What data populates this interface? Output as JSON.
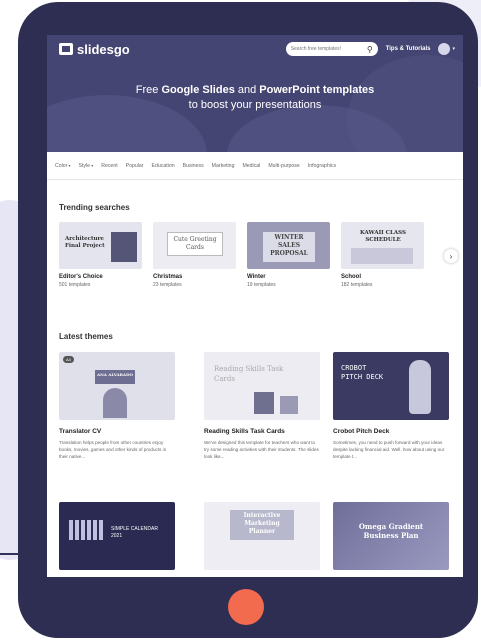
{
  "nav": {
    "logo": "slidesgo",
    "search_placeholder": "Search free templates!",
    "tips": "Tips & Tutorials"
  },
  "hero": {
    "title_pre": "Free ",
    "title_b1": "Google Slides",
    "title_mid": " and ",
    "title_b2": "PowerPoint templates",
    "subtitle": "to boost your presentations"
  },
  "categories": [
    "Color",
    "Style",
    "Recent",
    "Popular",
    "Education",
    "Business",
    "Marketing",
    "Medical",
    "Multi-purpose",
    "Infographics"
  ],
  "trending": {
    "title": "Trending searches",
    "items": [
      {
        "name": "Editor's Choice",
        "count": "501 templates",
        "thumb": "Architecture Final Project"
      },
      {
        "name": "Christmas",
        "count": "23 templates",
        "thumb": "Cute Greeting Cards"
      },
      {
        "name": "Winter",
        "count": "19 templates",
        "thumb": "WINTER SALES PROPOSAL"
      },
      {
        "name": "School",
        "count": "182 templates",
        "thumb": "KAWAII CLASS SCHEDULE"
      }
    ]
  },
  "latest": {
    "title": "Latest themes",
    "items": [
      {
        "name": "Translator CV",
        "badge": "A4",
        "thumb": "ANA ALVARADO",
        "desc": "Translation helps people from other countries enjoy books, movies, games and other kinds of products in their native..."
      },
      {
        "name": "Reading Skills Task Cards",
        "thumb": "Reading Skills Task Cards",
        "desc": "We've designed this template for teachers who want to try some reading activities with their students. The slides look like..."
      },
      {
        "name": "Crobot Pitch Deck",
        "thumb": "CROBOT PITCH DECK",
        "desc": "Sometimes, you need to push forward with your ideas despite lacking financial aid. Well, how about using our template t..."
      }
    ],
    "row2": [
      {
        "thumb": "SIMPLE CALENDAR 2021"
      },
      {
        "thumb": "Interactive Marketing Planner"
      },
      {
        "thumb": "Omega Gradient Business Plan"
      }
    ]
  },
  "colors": {
    "tablet": "#2e2e52",
    "hero": "#454573",
    "home_button": "#f26b4f"
  }
}
